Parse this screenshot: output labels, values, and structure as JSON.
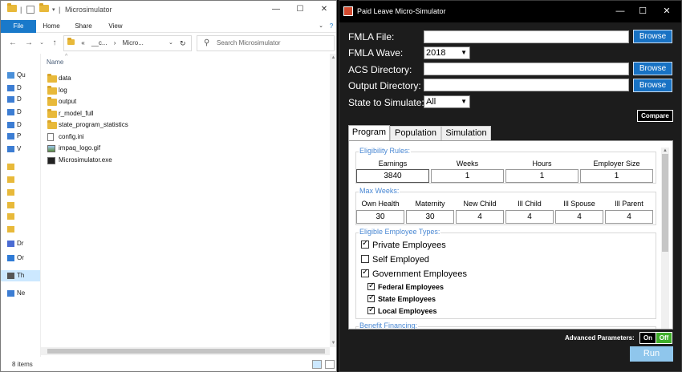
{
  "explorer": {
    "title": "Microsimulator",
    "ribbon_tabs": [
      "File",
      "Home",
      "Share",
      "View"
    ],
    "address": [
      "«",
      "__c...",
      "›",
      "Micro..."
    ],
    "search_placeholder": "Search Microsimulator",
    "nav_items": [
      "Qu",
      "D",
      "D",
      "D",
      "D",
      "P",
      "V",
      "",
      "",
      "",
      "",
      "",
      "",
      "Dr",
      "",
      "Or",
      "Th",
      "",
      "Ne"
    ],
    "column_name": "Name",
    "files": [
      {
        "name": "data",
        "icon": "folder-icon"
      },
      {
        "name": "log",
        "icon": "folder-icon"
      },
      {
        "name": "output",
        "icon": "folder-icon"
      },
      {
        "name": "r_model_full",
        "icon": "folder-icon"
      },
      {
        "name": "state_program_statistics",
        "icon": "folder-icon"
      },
      {
        "name": "config.ini",
        "icon": "file-icon"
      },
      {
        "name": "impaq_logo.gif",
        "icon": "image-icon"
      },
      {
        "name": "Microsimulator.exe",
        "icon": "exe-icon"
      }
    ],
    "status_count": "8 items"
  },
  "sim": {
    "title": "Paid Leave Micro-Simulator",
    "fmla_file_label": "FMLA File:",
    "fmla_wave_label": "FMLA Wave:",
    "fmla_wave_value": "2018",
    "acs_dir_label": "ACS Directory:",
    "output_dir_label": "Output Directory:",
    "state_label": "State to Simulate:",
    "state_value": "All",
    "browse_label": "Browse",
    "compare_label": "Compare",
    "tabs": [
      "Program",
      "Population",
      "Simulation"
    ],
    "eligibility": {
      "title": "Eligibility Rules:",
      "headers": [
        "Earnings",
        "Weeks",
        "Hours",
        "Employer Size"
      ],
      "values": [
        "3840",
        "1",
        "1",
        "1"
      ]
    },
    "max_weeks": {
      "title": "Max Weeks:",
      "headers": [
        "Own Health",
        "Maternity",
        "New Child",
        "Ill Child",
        "Ill Spouse",
        "Ill Parent"
      ],
      "values": [
        "30",
        "30",
        "4",
        "4",
        "4",
        "4"
      ]
    },
    "employee_types": {
      "title": "Eligible Employee Types:",
      "private": "Private Employees",
      "self": "Self Employed",
      "government": "Government Employees",
      "federal": "Federal Employees",
      "state": "State Employees",
      "local": "Local Employees"
    },
    "benefit_financing_title": "Benefit Financing:",
    "advanced_label": "Advanced Parameters:",
    "toggle_on": "On",
    "toggle_off": "Off",
    "run_label": "Run",
    "colors": {
      "accent": "#1872c4",
      "run": "#8fc6ec",
      "toggle_off": "#3fae2a",
      "group_title": "#4a88d3"
    }
  }
}
